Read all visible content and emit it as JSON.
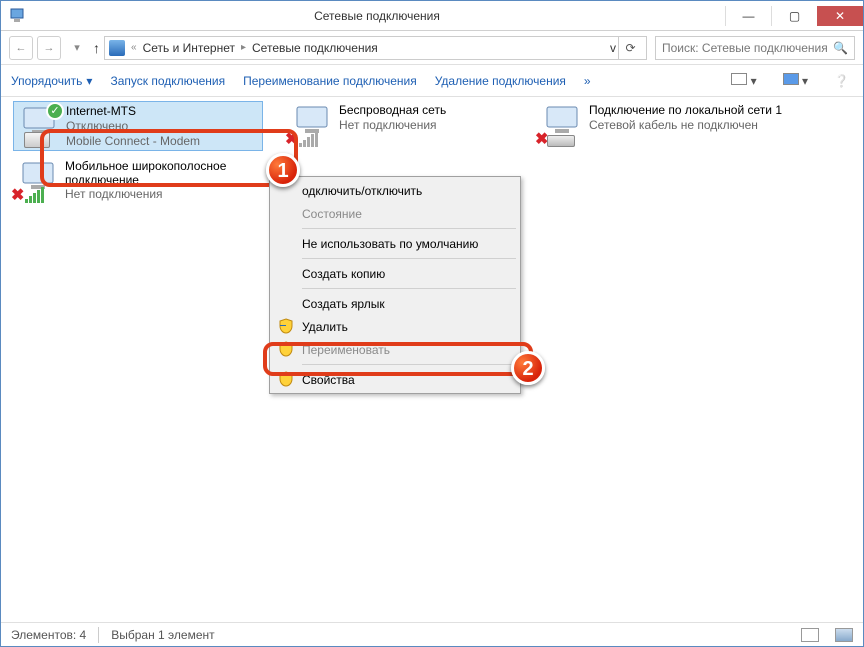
{
  "window": {
    "title": "Сетевые подключения"
  },
  "breadcrumb": {
    "chevron_left": "«",
    "seg1": "Сеть и Интернет",
    "seg2": "Сетевые подключения",
    "dropdown": "v"
  },
  "search": {
    "placeholder": "Поиск: Сетевые подключения"
  },
  "toolbar": {
    "organize": "Упорядочить",
    "start": "Запуск подключения",
    "rename": "Переименование подключения",
    "delete": "Удаление подключения",
    "more": "»"
  },
  "connections": {
    "internet_mts": {
      "name": "Internet-MTS",
      "status": "Отключено",
      "device": "Mobile Connect - Modem"
    },
    "wireless": {
      "name": "Беспроводная сеть",
      "status": "Нет подключения",
      "device": ""
    },
    "lan": {
      "name": "Подключение по локальной сети 1",
      "status": "Сетевой кабель не подключен",
      "device": ""
    },
    "mobile_broadband": {
      "name": "Мобильное широкополосное подключение",
      "status": "Нет подключения",
      "device": ""
    }
  },
  "context_menu": {
    "connect": "одключить/отключить",
    "state": "Состояние",
    "not_default": "Не использовать по умолчанию",
    "copy": "Создать копию",
    "shortcut": "Создать ярлык",
    "delete": "Удалить",
    "rename": "Переименовать",
    "properties": "Свойства"
  },
  "callouts": {
    "one": "1",
    "two": "2"
  },
  "statusbar": {
    "count": "Элементов: 4",
    "selected": "Выбран 1 элемент"
  }
}
